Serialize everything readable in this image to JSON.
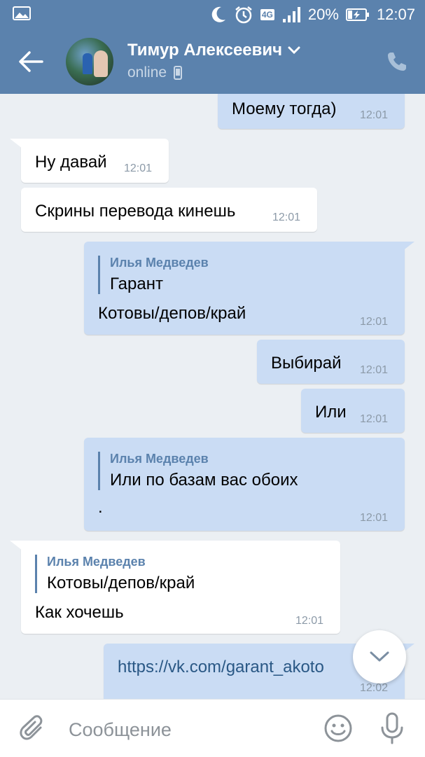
{
  "status_bar": {
    "battery": "20%",
    "time": "12:07",
    "network": "4G",
    "icons": [
      "gallery-icon",
      "moon-icon",
      "alarm-icon",
      "signal-icon",
      "battery-icon"
    ]
  },
  "header": {
    "contact_name": "Тимур Алексеевич",
    "status": "online",
    "icons": [
      "back-arrow-icon",
      "chevron-down-icon",
      "mobile-icon",
      "phone-icon"
    ]
  },
  "messages": [
    {
      "dir": "out",
      "text": "Моему тогда)",
      "time": "12:01"
    },
    {
      "dir": "in",
      "text": "Ну давай",
      "time": "12:01"
    },
    {
      "dir": "in",
      "text": "Скрины перевода кинешь",
      "time": "12:01"
    },
    {
      "dir": "out",
      "quote_author": "Илья Медведев",
      "quote_text": "Гарант",
      "text": "Котовы/депов/край",
      "time": "12:01"
    },
    {
      "dir": "out",
      "text": "Выбирай",
      "time": "12:01"
    },
    {
      "dir": "out",
      "text": "Или",
      "time": "12:01"
    },
    {
      "dir": "out",
      "quote_author": "Илья Медведев",
      "quote_text": "Или по базам вас обоих",
      "text": ".",
      "time": "12:01"
    },
    {
      "dir": "in",
      "quote_author": "Илья Медведев",
      "quote_text": "Котовы/депов/край",
      "text": "Как хочешь",
      "time": "12:01"
    },
    {
      "dir": "out",
      "text": "https://vk.com/garant_akoto",
      "time": "12:02"
    }
  ],
  "composer": {
    "placeholder": "Сообщение",
    "icons": [
      "attach-icon",
      "emoji-icon",
      "microphone-icon"
    ]
  },
  "colors": {
    "header_bg": "#5b82ad",
    "chat_bg": "#ebeff3",
    "out_bubble": "#cadcf4",
    "in_bubble": "#ffffff",
    "quote_accent": "#5b82ad"
  }
}
